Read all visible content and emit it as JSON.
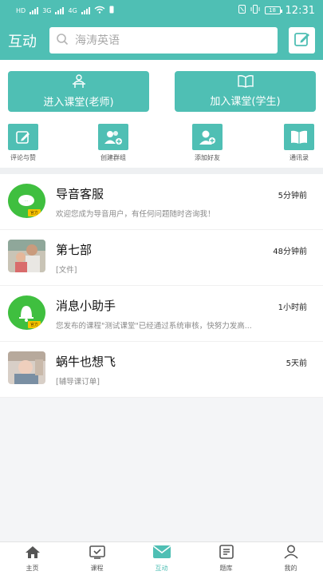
{
  "status_bar": {
    "left_labels": [
      "HD",
      "3G",
      "4G"
    ],
    "time": "12:31",
    "battery": "18"
  },
  "header": {
    "title": "互动",
    "search_placeholder": "海涛英语"
  },
  "actions": {
    "teacher_label": "进入课堂(老师)",
    "student_label": "加入课堂(学生)"
  },
  "quick_links": [
    {
      "label": "评论与赞"
    },
    {
      "label": "创建群组"
    },
    {
      "label": "添加好友"
    },
    {
      "label": "通讯录"
    }
  ],
  "messages": [
    {
      "name": "导音客服",
      "time": "5分钟前",
      "preview": "欢迎您成为导音用户，有任何问题随时咨询我！",
      "badge": "官方"
    },
    {
      "name": "第七部",
      "time": "48分钟前",
      "preview": "[文件]"
    },
    {
      "name": "消息小助手",
      "time": "1小时前",
      "preview": "您发布的课程\"测试课堂\"已经通过系统审核，快努力发高...",
      "badge": "官方"
    },
    {
      "name": "蜗牛也想飞",
      "time": "5天前",
      "preview": "[辅导课订单]"
    }
  ],
  "bottom_nav": [
    {
      "label": "主页"
    },
    {
      "label": "课程"
    },
    {
      "label": "互动"
    },
    {
      "label": "题库"
    },
    {
      "label": "我的"
    }
  ],
  "colors": {
    "accent": "#4fbfb4",
    "official_green": "#3fbf3f"
  },
  "icons": [
    "search-icon",
    "edit-icon",
    "teacher-icon",
    "book-icon",
    "comment-icon",
    "group-icon",
    "add-friend-icon",
    "contacts-icon",
    "home-icon",
    "course-icon",
    "message-icon",
    "quiz-icon",
    "profile-icon"
  ]
}
